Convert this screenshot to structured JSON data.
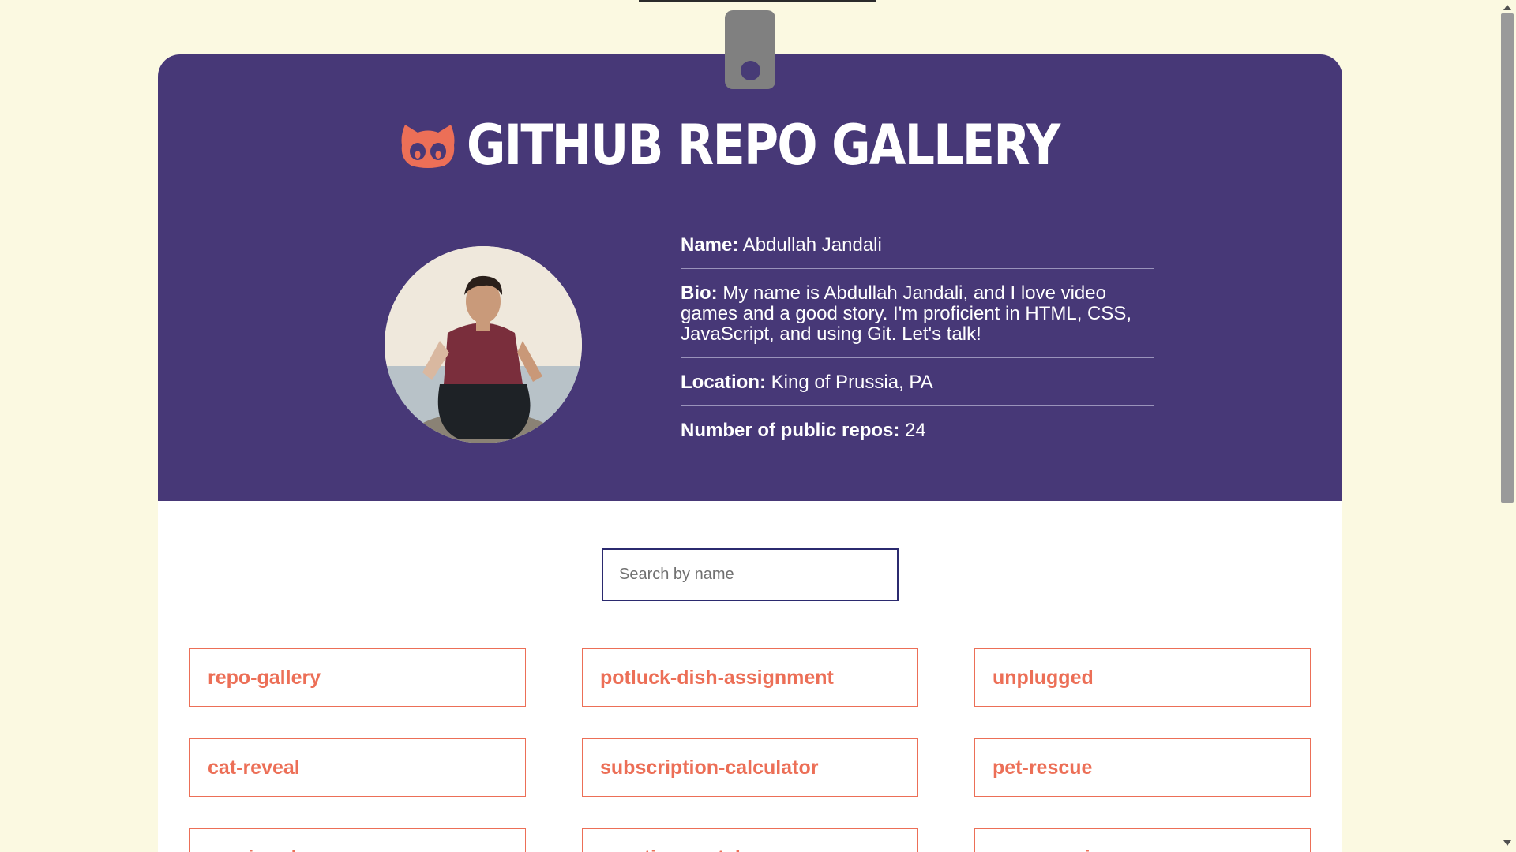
{
  "header": {
    "title": "GITHUB REPO GALLERY",
    "background_color": "#473877",
    "accent_color": "#ec6f57"
  },
  "profile": {
    "name_label": "Name:",
    "name": "Abdullah Jandali",
    "bio_label": "Bio:",
    "bio": "My name is Abdullah Jandali, and I love video games and a good story. I'm proficient in HTML, CSS, JavaScript, and using Git. Let's talk!",
    "location_label": "Location:",
    "location": "King of Prussia, PA",
    "repos_label": "Number of public repos:",
    "repos_count": "24"
  },
  "search": {
    "placeholder": "Search by name",
    "value": ""
  },
  "repos": [
    "repo-gallery",
    "potluck-dish-assignment",
    "unplugged",
    "cat-reveal",
    "subscription-calculator",
    "pet-rescue",
    "music-rules",
    "vacation-rentals",
    "my-guessing-game"
  ],
  "icons": {
    "logo": "octocat-icon",
    "clip": "badge-clip-icon"
  }
}
